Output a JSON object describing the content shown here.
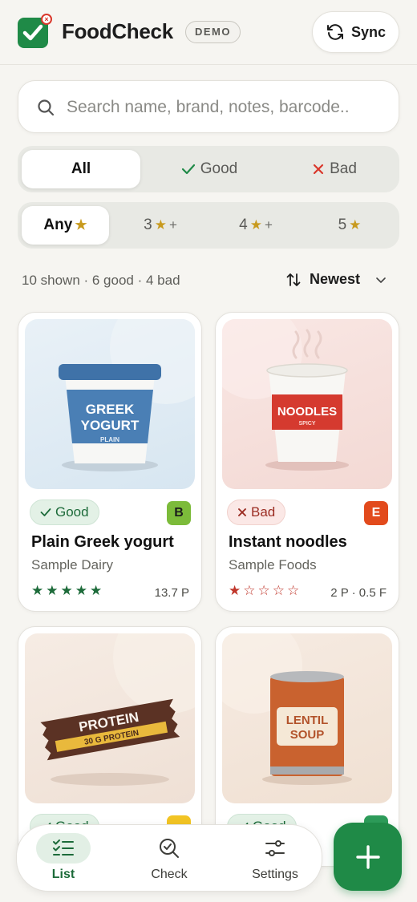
{
  "app": {
    "name": "FoodCheck",
    "mode_badge": "DEMO"
  },
  "header": {
    "sync_label": "Sync"
  },
  "search": {
    "placeholder": "Search name, brand, notes, barcode.."
  },
  "filters": {
    "verdict": [
      {
        "label": "All",
        "icon": "",
        "active": true
      },
      {
        "label": "Good",
        "icon": "check-icon",
        "active": false
      },
      {
        "label": "Bad",
        "icon": "x-icon",
        "active": false
      }
    ],
    "rating": [
      {
        "label": "Any",
        "active": true
      },
      {
        "label": "3",
        "suffix": "+",
        "active": false
      },
      {
        "label": "4",
        "suffix": "+",
        "active": false
      },
      {
        "label": "5",
        "active": false
      }
    ]
  },
  "summary": {
    "text": "10 shown · 6 good · 4 bad"
  },
  "sort": {
    "label": "Newest"
  },
  "items": [
    {
      "name": "Plain Greek yogurt",
      "brand": "Sample Dairy",
      "verdict": "Good",
      "grade": "B",
      "rating": 5,
      "meta": "13.7 P",
      "image_lines": [
        "GREEK",
        "YOGURT",
        "PLAIN"
      ]
    },
    {
      "name": "Instant noodles",
      "brand": "Sample Foods",
      "verdict": "Bad",
      "grade": "E",
      "rating": 1,
      "meta": "2 P · 0.5 F",
      "image_lines": [
        "NOODLES",
        "SPICY"
      ]
    },
    {
      "name": "",
      "brand": "",
      "verdict": "Good",
      "grade": "",
      "rating": null,
      "meta": "",
      "image_lines": [
        "PROTEIN",
        "30 G PROTEIN"
      ]
    },
    {
      "name": "",
      "brand": "",
      "verdict": "Good",
      "grade": "",
      "rating": null,
      "meta": "",
      "image_lines": [
        "LENTIL",
        "SOUP"
      ]
    }
  ],
  "nav": [
    {
      "label": "List",
      "icon": "checklist-icon",
      "active": true
    },
    {
      "label": "Check",
      "icon": "search-check-icon",
      "active": false
    },
    {
      "label": "Settings",
      "icon": "sliders-icon",
      "active": false
    }
  ],
  "fab": {
    "icon": "plus-icon"
  },
  "colors": {
    "primary": "#1f8a47",
    "good": "#1d6b3a",
    "bad": "#d9372b",
    "star": "#c89a1e",
    "grade_b": "#7cbb3a",
    "grade_e": "#e24a1c"
  }
}
